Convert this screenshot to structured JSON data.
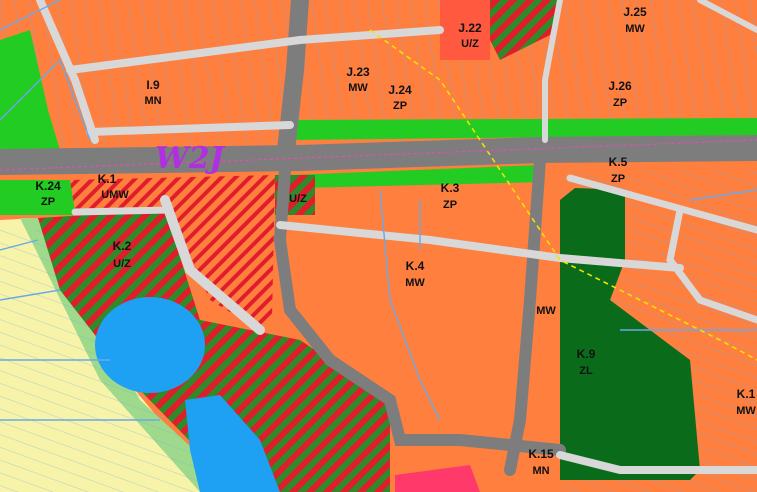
{
  "map": {
    "overlay_label": "W2J",
    "colors": {
      "residential_mw": "#ff7f3f",
      "green": "#22cc22",
      "dark_green": "#0a6b1a",
      "water": "#1ea1f2",
      "road": "#7d7d7d",
      "pale_yellow": "#f7f3a8",
      "pale_green": "#9fd98c",
      "hatch_red": "#e01e2b",
      "hatch_green": "#2f8a2a",
      "pink": "#ff3a6a",
      "boundary": "#6aa9e8",
      "overlay": "#b030e0"
    },
    "zones": [
      {
        "id": "zone-i9",
        "code": "I.9",
        "use": "MN"
      },
      {
        "id": "zone-j23",
        "code": "J.23",
        "use": "MW"
      },
      {
        "id": "zone-j24",
        "code": "J.24",
        "use": "ZP"
      },
      {
        "id": "zone-j22",
        "code": "J.22",
        "use": "U/Z"
      },
      {
        "id": "zone-j25",
        "code": "J.25",
        "use": "MW"
      },
      {
        "id": "zone-j26",
        "code": "J.26",
        "use": "ZP"
      },
      {
        "id": "zone-k24",
        "code": "K.24",
        "use": "ZP"
      },
      {
        "id": "zone-k1",
        "code": "K.1",
        "use": "UMW"
      },
      {
        "id": "zone-k2",
        "code": "K.2",
        "use": "U/Z"
      },
      {
        "id": "zone-k3",
        "code": "K.3",
        "use": "ZP"
      },
      {
        "id": "zone-k4",
        "code": "K.4",
        "use": "MW"
      },
      {
        "id": "zone-k5",
        "code": "K.5",
        "use": "ZP"
      },
      {
        "id": "zone-k9",
        "code": "K.9",
        "use": "ZL"
      },
      {
        "id": "zone-k15",
        "code": "K.15",
        "use": "MN"
      },
      {
        "id": "zone-k1x",
        "code": "K.1",
        "use": "MW"
      },
      {
        "id": "zone-mw-k8",
        "code": "",
        "use": "MW"
      },
      {
        "id": "zone-uz",
        "code": "",
        "use": "U/Z"
      }
    ]
  }
}
